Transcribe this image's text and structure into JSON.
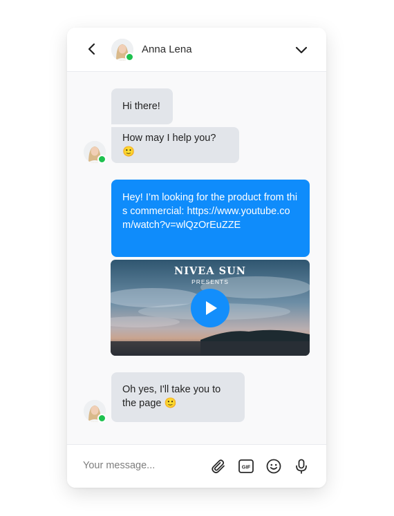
{
  "header": {
    "contact_name": "Anna Lena",
    "status": "online",
    "back_icon": "chevron-left-icon",
    "menu_icon": "chevron-down-icon"
  },
  "messages": [
    {
      "from": "agent",
      "text": "Hi there!"
    },
    {
      "from": "agent",
      "text": "How may I help you? 🙂"
    },
    {
      "from": "user",
      "text": "Hey! I’m looking for the product from this commercial: https://www.youtube.com/watch?v=wlQzOrEuZZE"
    },
    {
      "from": "agent",
      "text": "Oh yes, I'll take you to the page 🙂"
    }
  ],
  "video": {
    "title": "NIVEA SUN",
    "subtitle": "PRESENTS",
    "play_icon": "play-icon"
  },
  "composer": {
    "placeholder": "Your message...",
    "icons": [
      "paperclip-icon",
      "gif-icon",
      "emoji-icon",
      "microphone-icon"
    ]
  },
  "colors": {
    "accent": "#0f8cfb",
    "incoming_bubble": "#e2e5ea",
    "online": "#1ec14f"
  }
}
